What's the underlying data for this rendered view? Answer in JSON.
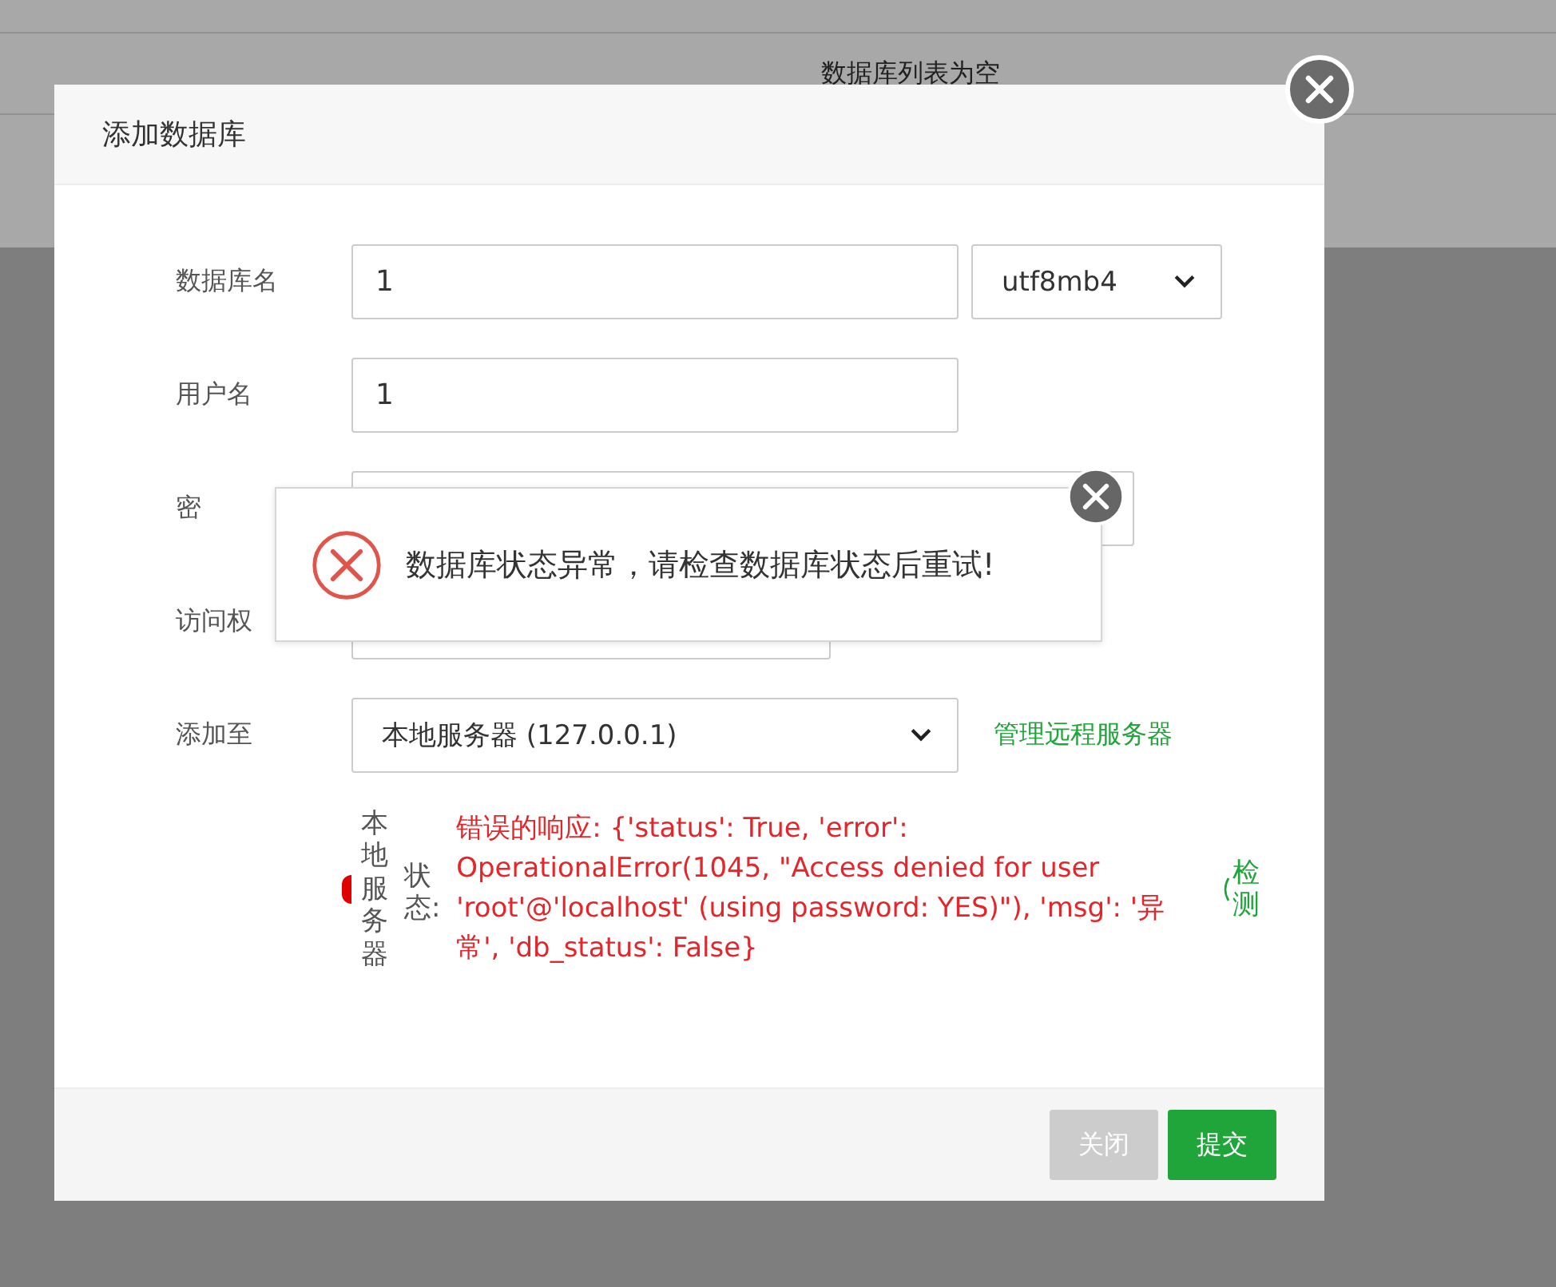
{
  "background_table": {
    "empty_message": "数据库列表为空"
  },
  "dialog": {
    "title": "添加数据库",
    "fields": [
      {
        "kind": "text_select",
        "label": "数据库名",
        "value": "1",
        "select": "utf8mb4"
      },
      {
        "kind": "text",
        "label": "用户名",
        "value": "1"
      },
      {
        "kind": "text_wide",
        "label": "密"
      },
      {
        "kind": "text_short",
        "label": "访问权"
      },
      {
        "kind": "select_link",
        "label": "添加至",
        "select": "本地服务器 (127.0.0.1)",
        "link": "管理远程服务器"
      }
    ],
    "server_status": {
      "server": "本地服务器",
      "label": "状态:",
      "message": "错误的响应: {'status': True, 'error': OperationalError(1045, \"Access denied for user 'root'@'localhost' (using password: YES)\"), 'msg': '异常', 'db_status': False}",
      "action": "检测"
    },
    "buttons": [
      {
        "label": "关闭",
        "kind": "secondary"
      },
      {
        "label": "提交",
        "kind": "primary"
      }
    ]
  },
  "toast": {
    "message": "数据库状态异常，请检查数据库状态后重试!"
  }
}
